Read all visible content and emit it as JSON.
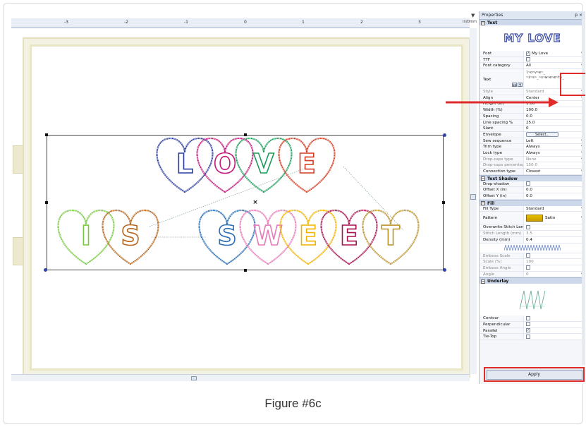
{
  "ruler": {
    "ticks": [
      "-3",
      "-2",
      "-1",
      "0",
      "1",
      "2",
      "3",
      "4"
    ],
    "unit": "in/Dmm"
  },
  "design": {
    "line1": [
      "L",
      "O",
      "V",
      "E"
    ],
    "line1_colors": [
      "#2b3d9e",
      "#c2187a",
      "#1b9b5a",
      "#d63a22"
    ],
    "line2a": [
      "I",
      "S"
    ],
    "line2a_colors": [
      "#7ac943",
      "#b5651d"
    ],
    "line2b": [
      "S",
      "W",
      "E",
      "E",
      "T"
    ],
    "line2b_colors": [
      "#2a6fb5",
      "#e67ab8",
      "#f2b400",
      "#a5124f",
      "#b9932c"
    ]
  },
  "panel": {
    "title": "Properties",
    "controls": "p ×",
    "preview_text": "MY LOVE",
    "sections": {
      "text": "Text",
      "text_shadow": "Text Shadow",
      "fill": "Fill",
      "underlay": "Underlay"
    },
    "text_rows": [
      {
        "k": "Font",
        "v": "My Love",
        "dd": true
      },
      {
        "k": "TTF",
        "v": "",
        "cb": true
      },
      {
        "k": "Font category",
        "v": "All",
        "dd": true
      }
    ],
    "text_value_lines": [
      "l~o~v~e~_",
      "~i~s~_~s~w~e~e~t~_"
    ],
    "text_label": "Text",
    "text_tools": [
      "ab",
      "¶"
    ],
    "style_rows": [
      {
        "k": "Style",
        "v": "Standard",
        "dd": true,
        "dim": true
      },
      {
        "k": "Align",
        "v": "Center",
        "dd": true
      },
      {
        "k": "Height (in)",
        "v": "1.00"
      },
      {
        "k": "Width (%)",
        "v": "100.0"
      },
      {
        "k": "Spacing",
        "v": "0.0"
      },
      {
        "k": "Line spacing %",
        "v": "25.0"
      },
      {
        "k": "Slant",
        "v": "0"
      },
      {
        "k": "Envelope",
        "v": "Select...",
        "btn": true
      },
      {
        "k": "Sew sequence",
        "v": "Left",
        "dd": true
      },
      {
        "k": "Trim type",
        "v": "Always",
        "dd": true
      },
      {
        "k": "Lock type",
        "v": "Always",
        "dd": true
      },
      {
        "k": "Drop-caps type",
        "v": "None",
        "dd": true,
        "dim": true
      },
      {
        "k": "Drop-caps percentage",
        "v": "150.0",
        "dim": true
      },
      {
        "k": "Connection type",
        "v": "Closest",
        "dd": true
      }
    ],
    "shadow_rows": [
      {
        "k": "Drop-shadow",
        "v": "",
        "cb": true
      },
      {
        "k": "Offset X (in)",
        "v": "0.0"
      },
      {
        "k": "Offset Y (in)",
        "v": "0.0"
      }
    ],
    "fill_rows": [
      {
        "k": "Fill Type",
        "v": "Standard",
        "dd": true
      }
    ],
    "pattern_label": "Pattern",
    "pattern_value": "Satin",
    "fill_rows2": [
      {
        "k": "Overwrite Stitch Leng...",
        "v": "",
        "cb": true
      },
      {
        "k": "Stitch Length (mm)",
        "v": "3.5",
        "dim": true
      },
      {
        "k": "Density (mm)",
        "v": "0.4"
      }
    ],
    "fill_rows3": [
      {
        "k": "Emboss Scale",
        "v": "",
        "cb": true,
        "dim": true
      },
      {
        "k": "Scale (%)",
        "v": "100",
        "dim": true
      },
      {
        "k": "Emboss Angle",
        "v": "",
        "cb": true,
        "dim": true
      },
      {
        "k": "Angle",
        "v": "0",
        "dd": true,
        "dim": true
      }
    ],
    "underlay_rows": [
      {
        "k": "Contour",
        "v": "",
        "cb": true
      },
      {
        "k": "Perpendicular",
        "v": "",
        "cb": true
      },
      {
        "k": "Parallel",
        "v": "✓",
        "cb": true
      },
      {
        "k": "Tie-Top",
        "v": "",
        "cb": true
      }
    ],
    "apply_label": "Apply"
  },
  "colors": {
    "highlight": "#e02b2b",
    "panel_header": "#cdd8ea",
    "hoop": "#f3f1e2"
  },
  "caption": "Figure #6c"
}
